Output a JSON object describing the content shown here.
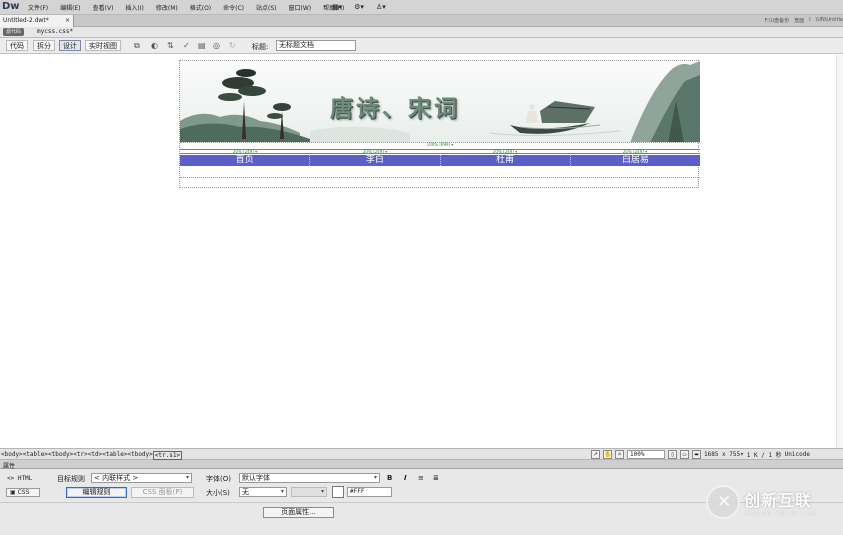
{
  "app": {
    "logo": "Dw"
  },
  "menu": [
    "文件(F)",
    "编辑(E)",
    "查看(V)",
    "插入(I)",
    "修改(M)",
    "格式(O)",
    "命令(C)",
    "站点(S)",
    "窗口(W)",
    "帮助(H)"
  ],
  "menu_tools": [
    "▦▾",
    "⚙▾",
    "♙▾"
  ],
  "doc_tab": {
    "label": "Untitled-2.dwt*",
    "close": "×"
  },
  "path_bar": [
    "F:\\U盘备份",
    "宽面",
    "I",
    "\\UN\\Untitle"
  ],
  "related_files": {
    "source": "源代码",
    "css": "mycss.css*"
  },
  "doc_toolbar": {
    "views": [
      "代码",
      "拆分",
      "设计",
      "实时视图"
    ],
    "active_view": "设计",
    "title_label": "标题:",
    "title_value": "无标题文档"
  },
  "banner": {
    "title": "唐诗、宋词"
  },
  "table_widths": {
    "total": "100% (999) ▾",
    "columns": [
      "20% (249) ▾",
      "20% (249) ▾",
      "20% (249) ▾",
      "20% (249) ▾"
    ]
  },
  "nav": [
    "首页",
    "李白",
    "杜甫",
    "白居易"
  ],
  "status": {
    "tags": [
      "<body>",
      "<table>",
      "<tbody>",
      "<tr>",
      "<td>",
      "<table>",
      "<tbody>"
    ],
    "current_tag": "<tr.s1>",
    "zoom": "100%",
    "dimensions": "1685 x 755▾",
    "size": "1 K / 1 秒",
    "encoding": "Unicode"
  },
  "properties": {
    "header": "属性",
    "html_button": "<> HTML",
    "css_button": "CSS",
    "target_rule_label": "目标规则",
    "target_rule_value": "< 内联样式 >",
    "edit_rule": "编辑规则",
    "css_panel": "CSS 面板(P)",
    "font_label": "字体(O)",
    "font_value": "默认字体",
    "size_label": "大小(S)",
    "size_value": "无",
    "color_value": "#FFF",
    "page_props": "页面属性..."
  },
  "watermark": {
    "text": "创新互联",
    "sub": "CHUANG XIN HU LIAN"
  },
  "colors": {
    "nav_bg": "#5b5fc7",
    "guide": "#3fa94a",
    "menubar": "#d4d4d4"
  }
}
